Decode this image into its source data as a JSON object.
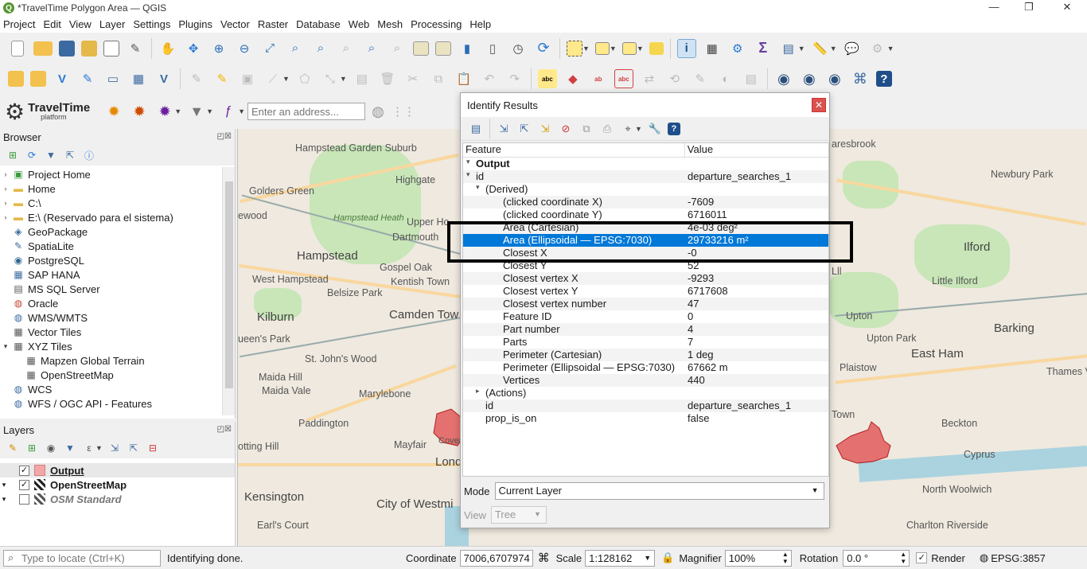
{
  "window": {
    "title": "*TravelTime Polygon Area — QGIS",
    "app_icon": "qgis-logo",
    "controls": [
      "—",
      "❐",
      "✕"
    ]
  },
  "menu": [
    "Project",
    "Edit",
    "View",
    "Layer",
    "Settings",
    "Plugins",
    "Vector",
    "Raster",
    "Database",
    "Web",
    "Mesh",
    "Processing",
    "Help"
  ],
  "plugin": {
    "name": "TravelTime",
    "subtitle": "platform",
    "address_placeholder": "Enter an address..."
  },
  "browser": {
    "title": "Browser",
    "items": [
      {
        "label": "Project Home",
        "icon": "project-home-icon",
        "expandable": true
      },
      {
        "label": "Home",
        "icon": "folder-icon",
        "expandable": true
      },
      {
        "label": "C:\\",
        "icon": "folder-icon",
        "expandable": true
      },
      {
        "label": "E:\\ (Reservado para el sistema)",
        "icon": "folder-icon",
        "expandable": true
      },
      {
        "label": "GeoPackage",
        "icon": "geopackage-icon",
        "expandable": false
      },
      {
        "label": "SpatiaLite",
        "icon": "spatialite-icon",
        "expandable": false
      },
      {
        "label": "PostgreSQL",
        "icon": "postgresql-icon",
        "expandable": false
      },
      {
        "label": "SAP HANA",
        "icon": "sap-hana-icon",
        "expandable": false
      },
      {
        "label": "MS SQL Server",
        "icon": "mssql-icon",
        "expandable": false
      },
      {
        "label": "Oracle",
        "icon": "oracle-icon",
        "expandable": false
      },
      {
        "label": "WMS/WMTS",
        "icon": "globe-icon",
        "expandable": false
      },
      {
        "label": "Vector Tiles",
        "icon": "grid-icon",
        "expandable": false
      },
      {
        "label": "XYZ Tiles",
        "icon": "grid-icon",
        "expandable": true,
        "expanded": true
      },
      {
        "label": "Mapzen Global Terrain",
        "icon": "grid-icon",
        "child": true
      },
      {
        "label": "OpenStreetMap",
        "icon": "grid-icon",
        "child": true
      },
      {
        "label": "WCS",
        "icon": "globe-icon",
        "expandable": false
      },
      {
        "label": "WFS / OGC API - Features",
        "icon": "globe-icon",
        "expandable": false
      }
    ]
  },
  "layers": {
    "title": "Layers",
    "items": [
      {
        "label": "Output",
        "checked": true,
        "swatch": "#f4a6a6",
        "style": "bold-underline"
      },
      {
        "label": "OpenStreetMap",
        "checked": true,
        "swatch": "grid",
        "style": "bold"
      },
      {
        "label": "OSM Standard",
        "checked": false,
        "swatch": "grid",
        "style": "bold-italic-grey"
      }
    ]
  },
  "map": {
    "labels": [
      "Hampstead Garden Suburb",
      "Highgate",
      "Golders Green",
      "Hampstead Heath",
      "Upper Ho",
      "Dartmouth",
      "Hampstead",
      "Gospel Oak",
      "West Hampstead",
      "Kentish Town",
      "Belsize Park",
      "Camden Tow",
      "Kilburn",
      "ueen's Park",
      "St. John's Wood",
      "Maida Hill",
      "Maida Vale",
      "Marylebone",
      "Paddington",
      "Mayfair",
      "Lond",
      "otting Hill",
      "Kensington",
      "City of Westmi",
      "Earl's Court",
      "Covent",
      "ewood",
      "aresbrook",
      "Newbury Park",
      "Ilford",
      "Little Ilford",
      "Upton",
      "Upton Park",
      "Barking",
      "East Ham",
      "Plaistow",
      "Thames Vie",
      "Beckton",
      "Cyprus",
      "North Woolwich",
      "Charlton Riverside",
      "Town",
      "Lll"
    ],
    "polygon_color": "#e0484a"
  },
  "identify": {
    "title": "Identify Results",
    "columns": [
      "Feature",
      "Value"
    ],
    "rows": [
      {
        "feature": "Output",
        "value": "",
        "indent": 0,
        "expander": "▾",
        "bold": true
      },
      {
        "feature": "id",
        "value": "departure_searches_1",
        "indent": 1,
        "expander": "▾"
      },
      {
        "feature": "(Derived)",
        "value": "",
        "indent": 2,
        "expander": "▾"
      },
      {
        "feature": "(clicked coordinate X)",
        "value": "-7609",
        "indent": 3
      },
      {
        "feature": "(clicked coordinate Y)",
        "value": "6716011",
        "indent": 3
      },
      {
        "feature": "Area (Cartesian)",
        "value": "4e-03 deg²",
        "indent": 3
      },
      {
        "feature": "Area (Ellipsoidal — EPSG:7030)",
        "value": "29733216 m²",
        "indent": 3,
        "selected": true
      },
      {
        "feature": "Closest X",
        "value": "-0",
        "indent": 3
      },
      {
        "feature": "Closest Y",
        "value": "52",
        "indent": 3
      },
      {
        "feature": "Closest vertex X",
        "value": "-9293",
        "indent": 3
      },
      {
        "feature": "Closest vertex Y",
        "value": "6717608",
        "indent": 3
      },
      {
        "feature": "Closest vertex number",
        "value": "47",
        "indent": 3
      },
      {
        "feature": "Feature ID",
        "value": "0",
        "indent": 3
      },
      {
        "feature": "Part number",
        "value": "4",
        "indent": 3
      },
      {
        "feature": "Parts",
        "value": "7",
        "indent": 3
      },
      {
        "feature": "Perimeter (Cartesian)",
        "value": "1 deg",
        "indent": 3
      },
      {
        "feature": "Perimeter (Ellipsoidal — EPSG:7030)",
        "value": "67662 m",
        "indent": 3
      },
      {
        "feature": "Vertices",
        "value": "440",
        "indent": 3
      },
      {
        "feature": "(Actions)",
        "value": "",
        "indent": 2,
        "expander": "▸"
      },
      {
        "feature": "id",
        "value": "departure_searches_1",
        "indent": 2
      },
      {
        "feature": "prop_is_on",
        "value": "false",
        "indent": 2
      }
    ],
    "mode_label": "Mode",
    "mode_value": "Current Layer",
    "view_label": "View",
    "view_value": "Tree"
  },
  "status": {
    "locate_placeholder": "Type to locate (Ctrl+K)",
    "message": "Identifying done.",
    "coordinate_label": "Coordinate",
    "coordinate_value": "7006,6707974",
    "scale_label": "Scale",
    "scale_value": "1:128162",
    "magnifier_label": "Magnifier",
    "magnifier_value": "100%",
    "rotation_label": "Rotation",
    "rotation_value": "0.0 °",
    "render_label": "Render",
    "render_checked": true,
    "crs": "EPSG:3857"
  },
  "colors": {
    "selection": "#0078d7",
    "accent_close": "#d9534f"
  }
}
